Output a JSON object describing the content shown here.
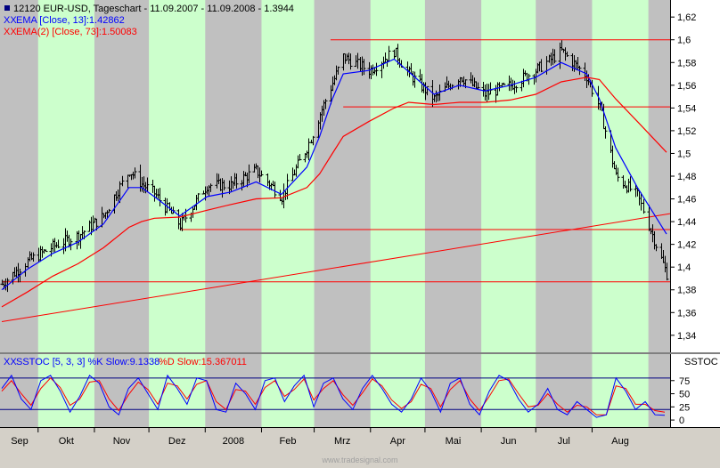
{
  "header": {
    "line1": "12120  EUR-USD, Tageschart - 11.09.2007 - 11.09.2008 - 1.3944",
    "line2_prefix": "XX",
    "line2": "EMA [Close, 13]:1.42862",
    "line3_prefix": "XX",
    "line3": "EMA(2) [Close, 73]:1.50083"
  },
  "stoch_header": {
    "prefix": "XX",
    "label_k": "SSTOC [5, 3, 3] %K Slow:9.1338",
    "label_d": "%D Slow:15.367011",
    "pane_tag": "SSTOC"
  },
  "watermark": "www.tradesignal.com",
  "colors": {
    "background": "#c0c0c0",
    "band_green": "#ccffcc",
    "candles": "#000000",
    "ema13": "#0000ff",
    "ema73": "#ff0000",
    "lines": "#ff0000",
    "stoch_k": "#0000ff",
    "stoch_d": "#ff0000"
  },
  "chart_data": [
    {
      "type": "line",
      "title": "EUR-USD, Tageschart",
      "x_labels": [
        "Sep",
        "Okt",
        "Nov",
        "Dez",
        "2008",
        "Feb",
        "Mrz",
        "Apr",
        "Mai",
        "Jun",
        "Jul",
        "Aug"
      ],
      "y_ticks": [
        "1,62",
        "1,6",
        "1,58",
        "1,56",
        "1,54",
        "1,52",
        "1,5",
        "1,48",
        "1,46",
        "1,44",
        "1,42",
        "1,4",
        "1,38",
        "1,36",
        "1,34"
      ],
      "ylim": [
        1.325,
        1.635
      ],
      "series": [
        {
          "name": "EUR-USD",
          "style": "ohlc-bars",
          "x": [
            "2007-09-11",
            "2007-09-25",
            "2007-10-09",
            "2007-10-23",
            "2007-11-06",
            "2007-11-20",
            "2007-11-27",
            "2007-12-04",
            "2007-12-18",
            "2008-01-02",
            "2008-01-15",
            "2008-01-29",
            "2008-02-12",
            "2008-02-26",
            "2008-03-04",
            "2008-03-11",
            "2008-03-17",
            "2008-03-31",
            "2008-04-14",
            "2008-04-22",
            "2008-05-06",
            "2008-05-20",
            "2008-06-03",
            "2008-06-17",
            "2008-07-01",
            "2008-07-15",
            "2008-07-29",
            "2008-08-05",
            "2008-08-14",
            "2008-08-26",
            "2008-09-11"
          ],
          "values": [
            1.385,
            1.405,
            1.418,
            1.428,
            1.445,
            1.485,
            1.473,
            1.465,
            1.437,
            1.472,
            1.472,
            1.485,
            1.462,
            1.505,
            1.535,
            1.562,
            1.585,
            1.573,
            1.59,
            1.57,
            1.548,
            1.568,
            1.552,
            1.56,
            1.573,
            1.59,
            1.568,
            1.54,
            1.48,
            1.463,
            1.394
          ]
        },
        {
          "name": "EMA [Close, 13]",
          "x": [
            "2007-09-11",
            "2007-09-25",
            "2007-10-09",
            "2007-10-23",
            "2007-11-06",
            "2007-11-20",
            "2007-11-27",
            "2007-12-04",
            "2007-12-18",
            "2008-01-02",
            "2008-01-15",
            "2008-01-29",
            "2008-02-12",
            "2008-02-26",
            "2008-03-04",
            "2008-03-11",
            "2008-03-17",
            "2008-03-31",
            "2008-04-14",
            "2008-04-22",
            "2008-05-06",
            "2008-05-20",
            "2008-06-03",
            "2008-06-17",
            "2008-07-01",
            "2008-07-15",
            "2008-07-29",
            "2008-08-05",
            "2008-08-14",
            "2008-08-26",
            "2008-09-11"
          ],
          "values": [
            1.38,
            1.398,
            1.412,
            1.422,
            1.438,
            1.47,
            1.47,
            1.462,
            1.445,
            1.462,
            1.466,
            1.475,
            1.464,
            1.488,
            1.515,
            1.548,
            1.57,
            1.573,
            1.583,
            1.572,
            1.552,
            1.56,
            1.555,
            1.56,
            1.567,
            1.58,
            1.57,
            1.548,
            1.505,
            1.47,
            1.429
          ]
        },
        {
          "name": "EMA(2) [Close, 73]",
          "x": [
            "2007-09-11",
            "2007-09-25",
            "2007-10-09",
            "2007-10-23",
            "2007-11-06",
            "2007-11-20",
            "2007-11-27",
            "2007-12-04",
            "2007-12-18",
            "2008-01-02",
            "2008-01-15",
            "2008-01-29",
            "2008-02-12",
            "2008-02-26",
            "2008-03-04",
            "2008-03-11",
            "2008-03-17",
            "2008-03-31",
            "2008-04-14",
            "2008-04-22",
            "2008-05-06",
            "2008-05-20",
            "2008-06-03",
            "2008-06-17",
            "2008-07-01",
            "2008-07-15",
            "2008-07-29",
            "2008-08-05",
            "2008-08-14",
            "2008-08-26",
            "2008-09-11"
          ],
          "values": [
            1.365,
            1.378,
            1.392,
            1.403,
            1.417,
            1.435,
            1.44,
            1.443,
            1.444,
            1.45,
            1.455,
            1.46,
            1.461,
            1.47,
            1.482,
            1.5,
            1.515,
            1.528,
            1.54,
            1.545,
            1.543,
            1.545,
            1.545,
            1.547,
            1.552,
            1.563,
            1.567,
            1.565,
            1.548,
            1.528,
            1.501
          ]
        }
      ],
      "reference_lines": [
        {
          "kind": "horizontal",
          "y": 1.6,
          "x_start": "2008-03-10",
          "x_end": "2008-09-11"
        },
        {
          "kind": "horizontal",
          "y": 1.541,
          "x_start": "2008-03-17",
          "x_end": "2008-09-11"
        },
        {
          "kind": "horizontal",
          "y": 1.433,
          "x_start": "2007-12-18",
          "x_end": "2008-09-11"
        },
        {
          "kind": "horizontal",
          "y": 1.387,
          "x_start": "2007-09-11",
          "x_end": "2008-09-11"
        },
        {
          "kind": "trendline",
          "x": [
            "2007-09-11",
            "2008-09-11"
          ],
          "y": [
            1.352,
            1.447
          ]
        }
      ],
      "grid": false,
      "shaded_months": [
        "Okt",
        "Dez",
        "Feb",
        "Apr",
        "Jun",
        "Aug"
      ]
    },
    {
      "type": "line",
      "title": "SSTOC [5, 3, 3]",
      "y_ticks": [
        "75",
        "50",
        "25",
        "0"
      ],
      "ylim": [
        -10,
        100
      ],
      "levels": [
        80,
        20
      ],
      "series": [
        {
          "name": "%K Slow",
          "values": [
            60,
            85,
            40,
            20,
            75,
            85,
            55,
            15,
            45,
            85,
            70,
            25,
            10,
            60,
            80,
            50,
            20,
            85,
            60,
            30,
            80,
            75,
            20,
            15,
            70,
            50,
            20,
            75,
            80,
            35,
            65,
            85,
            25,
            70,
            80,
            40,
            20,
            60,
            85,
            60,
            30,
            15,
            40,
            80,
            55,
            15,
            70,
            80,
            30,
            10,
            55,
            85,
            75,
            40,
            15,
            30,
            60,
            20,
            10,
            35,
            20,
            5,
            10,
            80,
            55,
            20,
            35,
            10,
            9
          ]
        },
        {
          "name": "%D Slow",
          "values": [
            55,
            75,
            50,
            28,
            60,
            80,
            62,
            28,
            40,
            72,
            75,
            40,
            18,
            48,
            72,
            58,
            30,
            70,
            65,
            40,
            68,
            75,
            35,
            20,
            58,
            55,
            30,
            62,
            75,
            45,
            58,
            78,
            38,
            60,
            75,
            48,
            28,
            52,
            78,
            65,
            38,
            22,
            35,
            68,
            60,
            25,
            58,
            75,
            40,
            18,
            45,
            75,
            78,
            50,
            25,
            28,
            50,
            30,
            15,
            28,
            25,
            10,
            10,
            65,
            60,
            30,
            30,
            18,
            15
          ]
        }
      ]
    }
  ]
}
